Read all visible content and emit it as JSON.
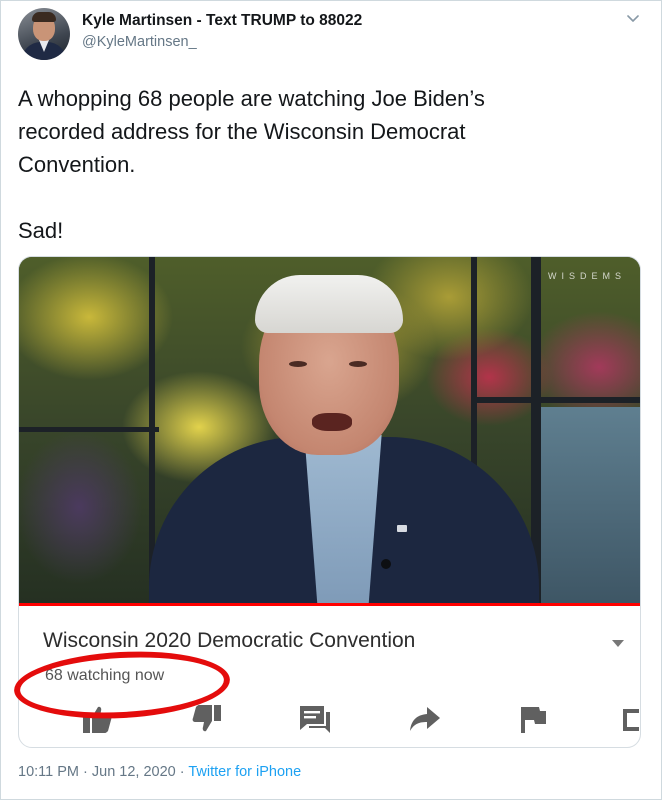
{
  "tweet": {
    "display_name": "Kyle Martinsen - Text TRUMP to 88022",
    "handle": "@KyleMartinsen_",
    "text": "A whopping 68 people are watching Joe Biden’s\nrecorded address for the Wisconsin Democrat\nConvention.\n\nSad!",
    "timestamp": "10:11 PM · Jun 12, 2020 · ",
    "source": "Twitter for iPhone"
  },
  "embedded_video": {
    "title": "Wisconsin 2020 Democratic Convention",
    "viewers": "68 watching now",
    "watermark": "WISDEMS",
    "actions": [
      "like-icon",
      "dislike-icon",
      "chat-icon",
      "share-icon",
      "flag-icon",
      "subscriptions-icon"
    ]
  },
  "colors": {
    "highlight_circle": "#e40c0c",
    "progress_bar": "#ff0000",
    "link": "#1da1f2",
    "secondary_text": "#657786"
  }
}
